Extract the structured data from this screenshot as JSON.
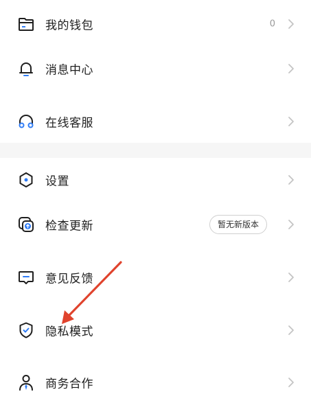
{
  "menu": {
    "wallet": {
      "label": "我的钱包",
      "value": "0",
      "icon": "wallet-icon"
    },
    "messages": {
      "label": "消息中心",
      "icon": "bell-icon"
    },
    "support": {
      "label": "在线客服",
      "icon": "headset-icon"
    },
    "settings": {
      "label": "设置",
      "icon": "hexagon-settings-icon"
    },
    "update": {
      "label": "检查更新",
      "badge": "暂无新版本",
      "icon": "update-icon"
    },
    "feedback": {
      "label": "意见反馈",
      "icon": "feedback-icon"
    },
    "privacy": {
      "label": "隐私模式",
      "icon": "shield-check-icon"
    },
    "business": {
      "label": "商务合作",
      "icon": "user-tie-icon"
    }
  },
  "colors": {
    "accent": "#2f7cf6",
    "icon_stroke": "#1f1f1f",
    "annotation_arrow": "#e0432d",
    "divider": "#f6f6f6"
  }
}
